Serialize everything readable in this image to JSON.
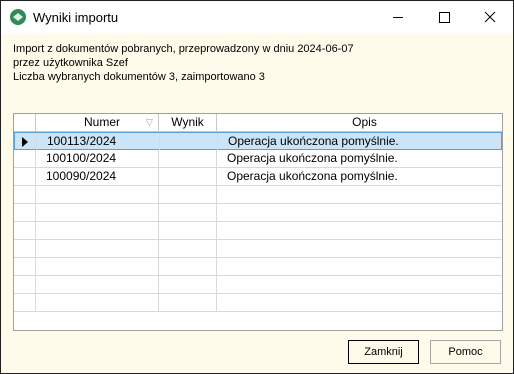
{
  "window": {
    "title": "Wyniki importu",
    "app_icon": "app-icon"
  },
  "titlebar_buttons": {
    "minimize": "minimize-icon",
    "maximize": "maximize-icon",
    "close": "close-icon"
  },
  "info": {
    "line1": "Import z dokumentów pobranych, przeprowadzony w dniu 2024-06-07",
    "line2": "przez użytkownika Szef",
    "line3": "Liczba wybranych dokumentów 3, zaimportowano 3"
  },
  "table": {
    "columns": [
      "Numer",
      "Wynik",
      "Opis"
    ],
    "rows": [
      {
        "numer": "100113/2024",
        "wynik": "",
        "opis": "Operacja ukończona pomyślnie.",
        "selected": true
      },
      {
        "numer": "100100/2024",
        "wynik": "",
        "opis": "Operacja ukończona pomyślnie.",
        "selected": false
      },
      {
        "numer": "100090/2024",
        "wynik": "",
        "opis": "Operacja ukończona pomyślnie.",
        "selected": false
      }
    ],
    "empty_rows": 7
  },
  "buttons": {
    "close_label": "Zamknij",
    "help_label": "Pomoc"
  },
  "colors": {
    "background": "#fefbea",
    "selection": "#cce4f7",
    "selection_border": "#5aa0d8"
  }
}
